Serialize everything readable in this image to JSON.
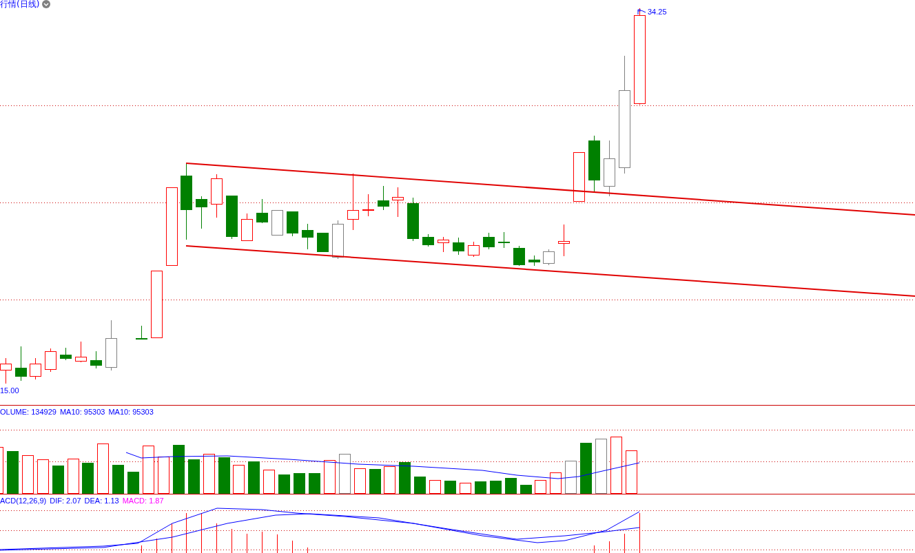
{
  "chart": {
    "title": "行情(日线)",
    "high_label": "34.25",
    "low_label": "15.00"
  },
  "volume_legend": [
    {
      "text": "OLUME: 134929",
      "color": "#0000ff"
    },
    {
      "text": "MA10: 95303",
      "color": "#0000ff"
    },
    {
      "text": "MA10: 95303",
      "color": "#0000ff"
    }
  ],
  "macd_legend": [
    {
      "text": "ACD(12,26,9)",
      "color": "#0000ff"
    },
    {
      "text": "DIF: 2.07",
      "color": "#0000ff"
    },
    {
      "text": "DEA: 1.13",
      "color": "#0000ff"
    },
    {
      "text": "MACD: 1.87",
      "color": "#ff00ff"
    }
  ]
}
